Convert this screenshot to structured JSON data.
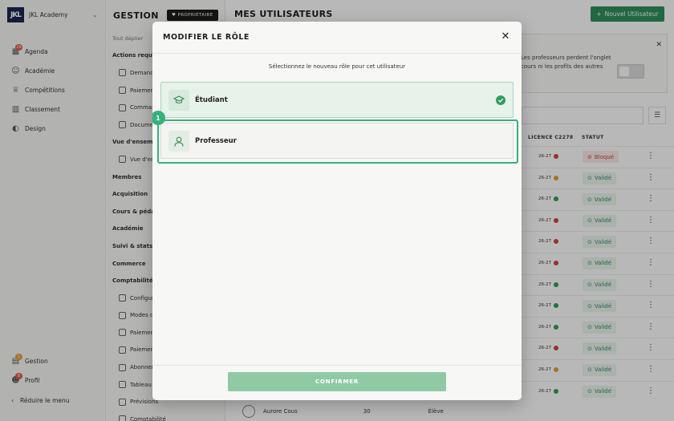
{
  "sidebar": {
    "brand": "JKL Academy",
    "logo_text": "JKL",
    "items": [
      {
        "label": "Agenda",
        "icon": "calendar-icon",
        "badge": "29"
      },
      {
        "label": "Académie",
        "icon": "users-icon",
        "badge": ""
      },
      {
        "label": "Compétitions",
        "icon": "trophy-icon",
        "badge": ""
      },
      {
        "label": "Classement",
        "icon": "ranking-icon",
        "badge": ""
      },
      {
        "label": "Design",
        "icon": "palette-icon",
        "badge": ""
      }
    ],
    "bottom_items": [
      {
        "label": "Gestion",
        "icon": "briefcase-icon",
        "badge": "1"
      },
      {
        "label": "Profil",
        "icon": "user-icon",
        "badge": "8"
      }
    ],
    "collapse_label": "Réduire le menu"
  },
  "management": {
    "title": "GESTION",
    "owner_badge": "PROPRIÉTAIRE",
    "rows": [
      {
        "label": "Tout déplier",
        "kind": "muted"
      },
      {
        "label": "Actions requises",
        "kind": "head"
      },
      {
        "label": "Demandes",
        "kind": "sub"
      },
      {
        "label": "Paiements",
        "kind": "sub"
      },
      {
        "label": "Commandes",
        "kind": "sub"
      },
      {
        "label": "Documents",
        "kind": "sub"
      },
      {
        "label": "Vue d'ensemble",
        "kind": "head"
      },
      {
        "label": "Vue d'ensemble",
        "kind": "sub"
      },
      {
        "label": "Membres",
        "kind": "head"
      },
      {
        "label": "Acquisition",
        "kind": "head"
      },
      {
        "label": "Cours & pédagogie",
        "kind": "head"
      },
      {
        "label": "Académie",
        "kind": "head"
      },
      {
        "label": "Suivi & stats",
        "kind": "head"
      },
      {
        "label": "Commerce",
        "kind": "head"
      },
      {
        "label": "Comptabilité & finances",
        "kind": "head"
      },
      {
        "label": "Configuration",
        "kind": "sub"
      },
      {
        "label": "Modes de paiement",
        "kind": "sub"
      },
      {
        "label": "Paiements",
        "kind": "sub"
      },
      {
        "label": "Paiements",
        "kind": "sub"
      },
      {
        "label": "Abonnements",
        "kind": "sub"
      },
      {
        "label": "Tableau de bord",
        "kind": "sub"
      },
      {
        "label": "Prévisions",
        "kind": "sub"
      },
      {
        "label": "Comptabilité",
        "kind": "sub"
      }
    ]
  },
  "main": {
    "title": "MES UTILISATEURS",
    "new_user_label": "Nouvel Utilisateur",
    "info_text": "Les professeurs perdent l'onglet cours ni les profils des autres",
    "columns": {
      "license": "LICENCE C2278",
      "status": "STATUT"
    },
    "rows": [
      {
        "license": "26-27",
        "lic_color": "#d0463a",
        "status": "Bloqué",
        "kind": "blk"
      },
      {
        "license": "26-27",
        "lic_color": "#e9a036",
        "status": "Validé",
        "kind": "ok"
      },
      {
        "license": "26-27",
        "lic_color": "#2f9e5e",
        "status": "Validé",
        "kind": "ok"
      },
      {
        "license": "26-27",
        "lic_color": "#d0463a",
        "status": "Validé",
        "kind": "ok"
      },
      {
        "license": "26-27",
        "lic_color": "#d0463a",
        "status": "Validé",
        "kind": "ok"
      },
      {
        "license": "26-27",
        "lic_color": "#d0463a",
        "status": "Validé",
        "kind": "ok"
      },
      {
        "license": "26-27",
        "lic_color": "#2f9e5e",
        "status": "Validé",
        "kind": "ok"
      },
      {
        "license": "26-27",
        "lic_color": "#2f9e5e",
        "status": "Validé",
        "kind": "ok"
      },
      {
        "license": "26-27",
        "lic_color": "#2f9e5e",
        "status": "Validé",
        "kind": "ok"
      },
      {
        "license": "26-27",
        "lic_color": "#d0463a",
        "status": "Validé",
        "kind": "ok"
      },
      {
        "license": "26-27",
        "lic_color": "#e9a036",
        "status": "Validé",
        "kind": "ok"
      },
      {
        "license": "26-27",
        "lic_color": "#2f9e5e",
        "status": "Validé",
        "kind": "ok"
      }
    ],
    "last_row": {
      "name": "Aurore Cous",
      "age": "30",
      "role": "Élève"
    }
  },
  "modal": {
    "title": "MODIFIER LE RÔLE",
    "subtitle": "Sélectionnez le nouveau rôle pour cet utilisateur",
    "options": [
      {
        "label": "Étudiant",
        "icon": "graduation-cap-icon",
        "selected": true
      },
      {
        "label": "Professeur",
        "icon": "user-icon",
        "selected": false
      }
    ],
    "step_number": "1",
    "confirm_label": "CONFIRMER"
  },
  "colors": {
    "accent": "#35b27a",
    "brand_dark": "#1b2452",
    "confirm_disabled": "#8fcaa5"
  }
}
